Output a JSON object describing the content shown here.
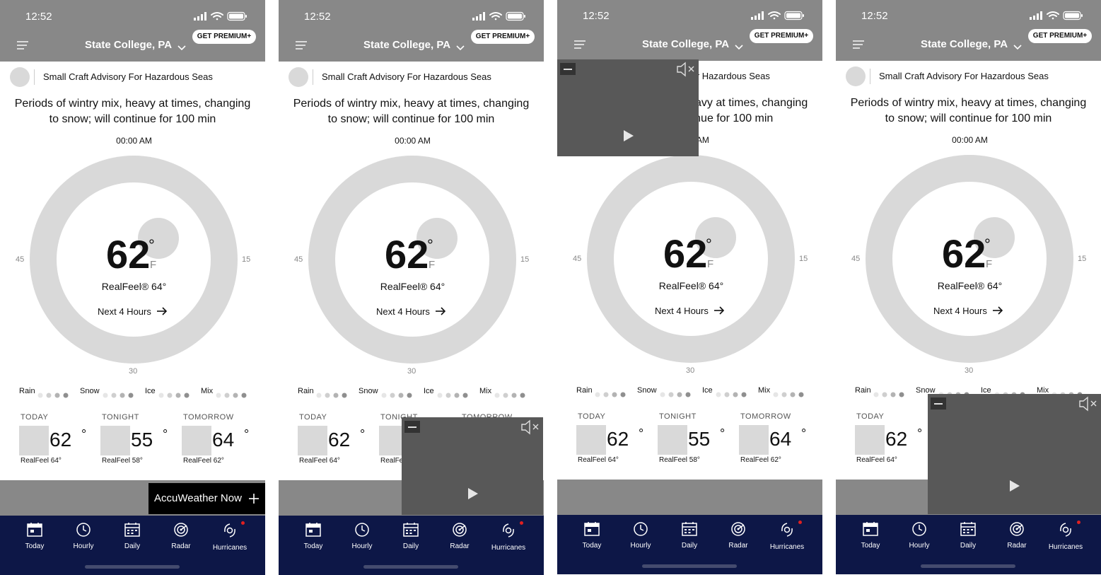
{
  "status_bar": {
    "time": "12:52"
  },
  "header": {
    "location": "State College, PA",
    "premium_button": "GET PREMIUM+"
  },
  "advisory": {
    "text": "Small Craft Advisory For Hazardous Seas"
  },
  "minutecast": {
    "summary_line1": "Periods of wintry mix, heavy at times, changing",
    "summary_line2": "to snow; will continue for 100 min",
    "dial_time": "00:00 AM",
    "dial_labels": {
      "left": "45",
      "right": "15",
      "bottom": "30"
    }
  },
  "current": {
    "temp": "62",
    "degree": "°",
    "unit": "F",
    "realfeel_label": "RealFeel®",
    "realfeel_value": "64°",
    "next_link": "Next 4 Hours"
  },
  "precip_legend": [
    "Rain",
    "Snow",
    "Ice",
    "Mix"
  ],
  "forecast": [
    {
      "label": "TODAY",
      "temp": "62",
      "deg": "°",
      "realfeel": "RealFeel 64°"
    },
    {
      "label": "TONIGHT",
      "temp": "55",
      "deg": "°",
      "realfeel": "RealFeel 58°"
    },
    {
      "label": "TOMORROW",
      "temp": "64",
      "deg": "°",
      "realfeel": "RealFeel 62°"
    }
  ],
  "accuweather_now": {
    "label": "AccuWeather Now"
  },
  "tabs": [
    "Today",
    "Hourly",
    "Daily",
    "Radar",
    "Hurricanes"
  ],
  "colors": {
    "header": "#888888",
    "tabbar": "#0d1747",
    "placeholder": "#d9d9d9",
    "video": "#585858",
    "badge": "#e02020"
  },
  "icons": {
    "status": [
      "signal-icon",
      "wifi-icon",
      "battery-icon"
    ],
    "header": [
      "menu-icon",
      "chevron-down-icon"
    ],
    "video": [
      "minimize-icon",
      "mute-icon",
      "play-icon"
    ],
    "tabs": [
      "calendar-icon",
      "clock-icon",
      "calendar-grid-icon",
      "radar-icon",
      "hurricane-icon"
    ]
  }
}
